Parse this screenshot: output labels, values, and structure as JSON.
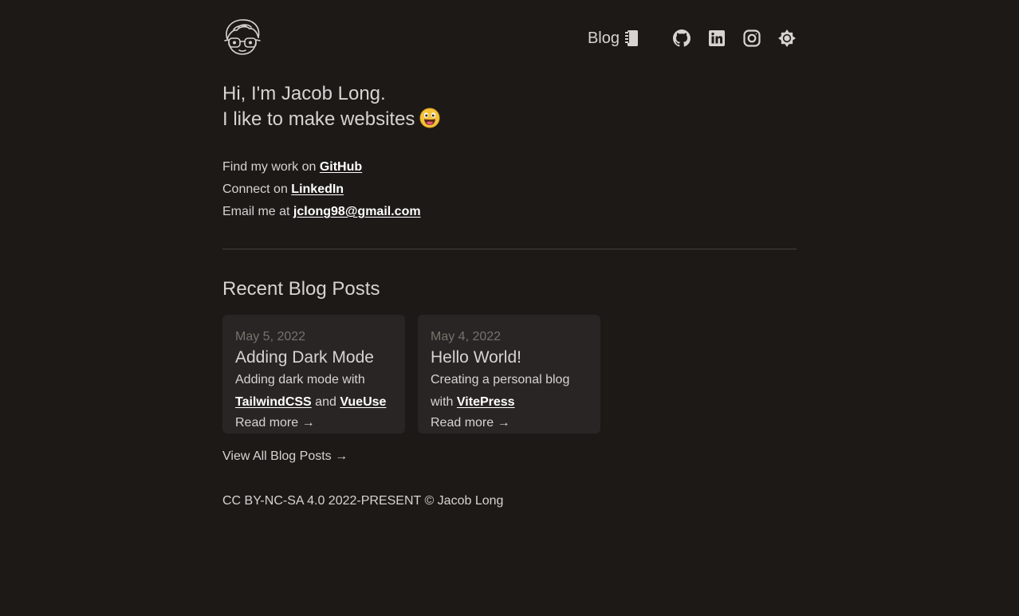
{
  "nav": {
    "blog_label": "Blog"
  },
  "intro": {
    "line1": "Hi, I'm Jacob Long.",
    "line2": "I like to make websites"
  },
  "contacts": {
    "github_prefix": "Find my work on",
    "github_link": "GitHub",
    "linkedin_prefix": "Connect on",
    "linkedin_link": "LinkedIn",
    "email_prefix": "Email me at",
    "email_link": "jclong98@gmail.com"
  },
  "recent": {
    "heading": "Recent Blog Posts",
    "posts": [
      {
        "date": "May 5, 2022",
        "title": "Adding Dark Mode",
        "desc_prefix": "Adding dark mode with",
        "link1": "TailwindCSS",
        "joiner": "and",
        "link2": "VueUse",
        "read_more": "Read more →"
      },
      {
        "date": "May 4, 2022",
        "title": "Hello World!",
        "desc_prefix": "Creating a personal blog with",
        "link1": "VitePress",
        "read_more": "Read more →"
      }
    ],
    "view_all": "View All Blog Posts →"
  },
  "footer": {
    "text": "CC BY-NC-SA 4.0 2022-PRESENT © Jacob Long"
  },
  "colors": {
    "background": "#1c1917",
    "text": "#d6d3d1",
    "card": "#292524",
    "muted": "#78716c",
    "link": "#ffffff"
  },
  "icons": [
    "avatar-logo",
    "notebook-icon",
    "github-icon",
    "linkedin-icon",
    "instagram-icon",
    "sun-icon",
    "grinning-emoji"
  ]
}
